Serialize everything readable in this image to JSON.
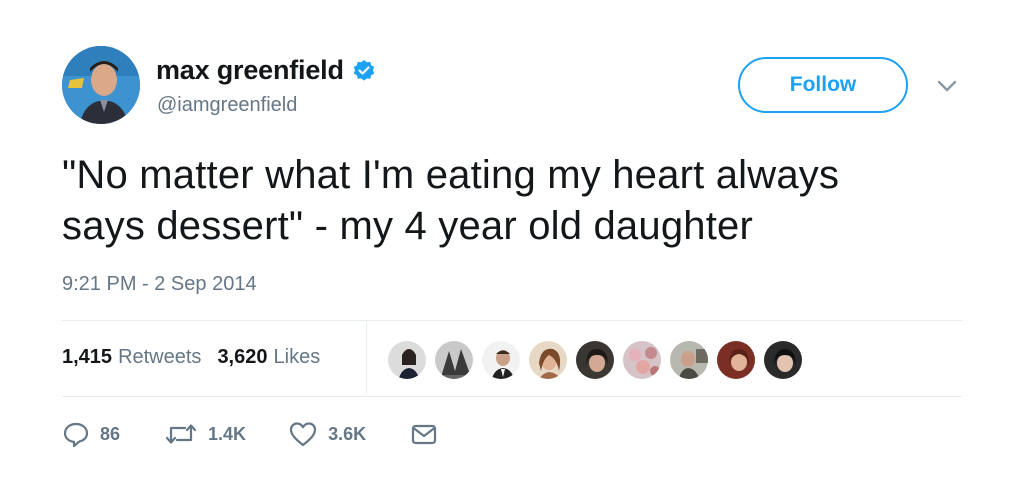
{
  "user": {
    "display_name": "max greenfield",
    "handle": "@iamgreenfield",
    "verified": true
  },
  "follow_label": "Follow",
  "tweet": {
    "text_line1": "\"No matter what I'm eating my heart always",
    "text_line2": "says dessert\" - my 4 year old daughter",
    "timestamp": "9:21 PM - 2 Sep 2014"
  },
  "stats": {
    "retweets_count": "1,415",
    "retweets_label": "Retweets",
    "likes_count": "3,620",
    "likes_label": "Likes"
  },
  "actions": {
    "reply_count": "86",
    "retweet_count": "1.4K",
    "like_count": "3.6K"
  },
  "icons": [
    "verified-badge-icon",
    "chevron-down-icon",
    "reply-icon",
    "retweet-icon",
    "heart-icon",
    "envelope-icon"
  ],
  "colors": {
    "accent": "#1da1f2",
    "text": "#14171a",
    "muted": "#657786",
    "divider": "#e6ecf0"
  }
}
